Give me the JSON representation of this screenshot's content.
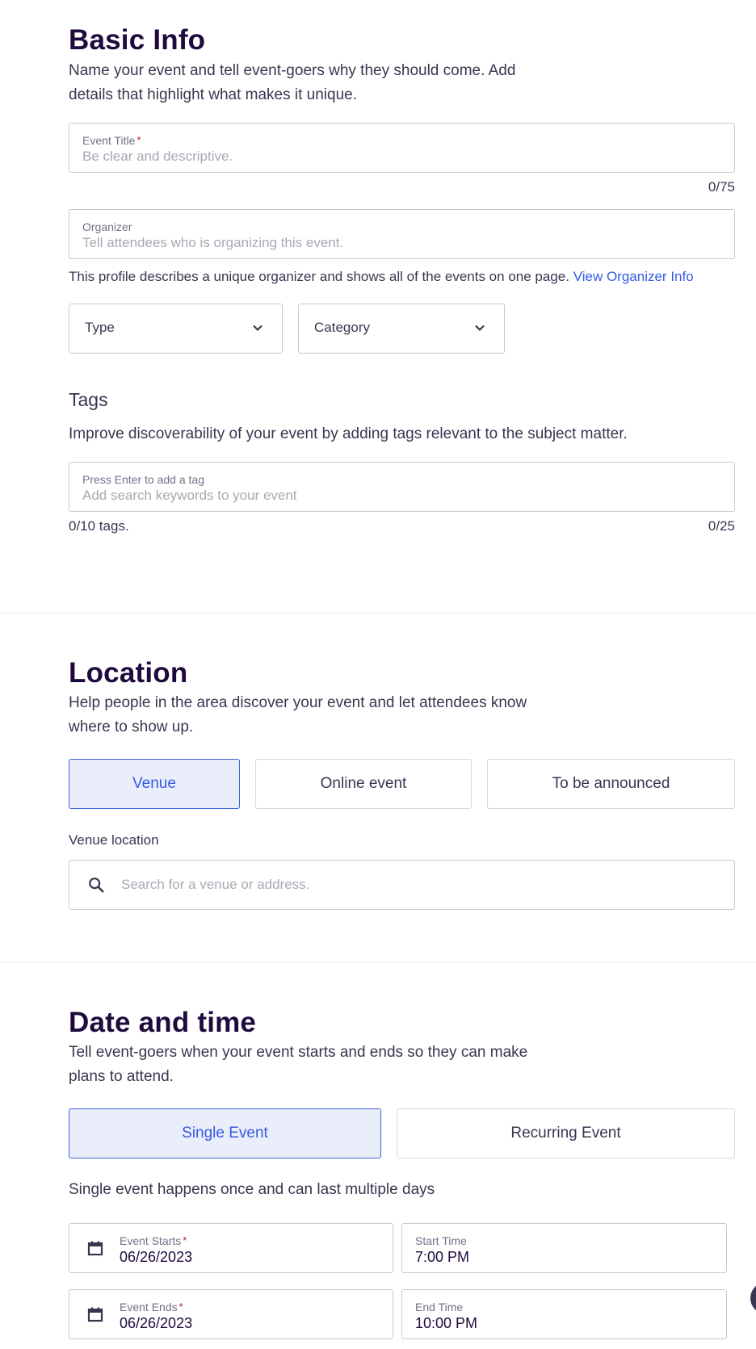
{
  "basic_info": {
    "title": "Basic Info",
    "description": "Name your event and tell event-goers why they should come. Add details that highlight what makes it unique.",
    "event_title": {
      "label": "Event Title",
      "required_mark": "*",
      "placeholder": "Be clear and descriptive.",
      "counter": "0/75"
    },
    "organizer": {
      "label": "Organizer",
      "placeholder": "Tell attendees who is organizing this event."
    },
    "organizer_help": "This profile describes a unique organizer and shows all of the events on one page.",
    "organizer_link": "View Organizer Info",
    "type_select": "Type",
    "category_select": "Category"
  },
  "tags": {
    "title": "Tags",
    "description": "Improve discoverability of your event by adding tags relevant to the subject matter.",
    "input": {
      "label": "Press Enter to add a tag",
      "placeholder": "Add search keywords to your event"
    },
    "tag_count": "0/10 tags.",
    "char_count": "0/25"
  },
  "location": {
    "title": "Location",
    "description": "Help people in the area discover your event and let attendees know where to show up.",
    "options": [
      "Venue",
      "Online event",
      "To be announced"
    ],
    "selected_index": 0,
    "venue_label": "Venue location",
    "search_placeholder": "Search for a venue or address."
  },
  "date_time": {
    "title": "Date and time",
    "description": "Tell event-goers when your event starts and ends so they can make plans to attend.",
    "options": [
      "Single Event",
      "Recurring Event"
    ],
    "selected_index": 0,
    "single_help": "Single event happens once and can last multiple days",
    "event_starts": {
      "label": "Event Starts",
      "required_mark": "*",
      "value": "06/26/2023"
    },
    "start_time": {
      "label": "Start Time",
      "value": "7:00 PM"
    },
    "event_ends": {
      "label": "Event Ends",
      "required_mark": "*",
      "value": "06/26/2023"
    },
    "end_time": {
      "label": "End Time",
      "value": "10:00 PM"
    }
  },
  "colors": {
    "heading": "#1e0a3c",
    "accent": "#3659e3",
    "selected_bg": "#eaeefb",
    "required": "#c5162e"
  }
}
